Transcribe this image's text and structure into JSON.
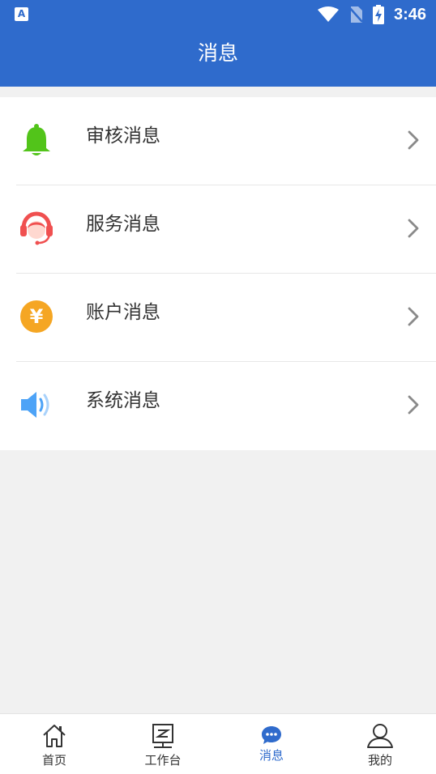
{
  "status_bar": {
    "left_icon": "A",
    "time": "3:46",
    "icons": [
      "wifi-icon",
      "no-sim-icon",
      "battery-charging-icon"
    ]
  },
  "header": {
    "title": "消息"
  },
  "messages": {
    "items": [
      {
        "label": "审核消息",
        "icon": "bell-icon",
        "color": "#52c41a"
      },
      {
        "label": "服务消息",
        "icon": "customer-service-icon",
        "color": "#f05050"
      },
      {
        "label": "账户消息",
        "icon": "yuan-coin-icon",
        "color": "#f5a623",
        "glyph": "¥"
      },
      {
        "label": "系统消息",
        "icon": "speaker-icon",
        "color": "#4da3f7"
      }
    ]
  },
  "tabbar": {
    "items": [
      {
        "label": "首页",
        "icon": "home-icon"
      },
      {
        "label": "工作台",
        "icon": "workbench-icon"
      },
      {
        "label": "消息",
        "icon": "chat-bubble-icon",
        "active": true
      },
      {
        "label": "我的",
        "icon": "person-icon"
      }
    ]
  },
  "colors": {
    "primary": "#2f6bcc",
    "background": "#f1f1f1"
  }
}
